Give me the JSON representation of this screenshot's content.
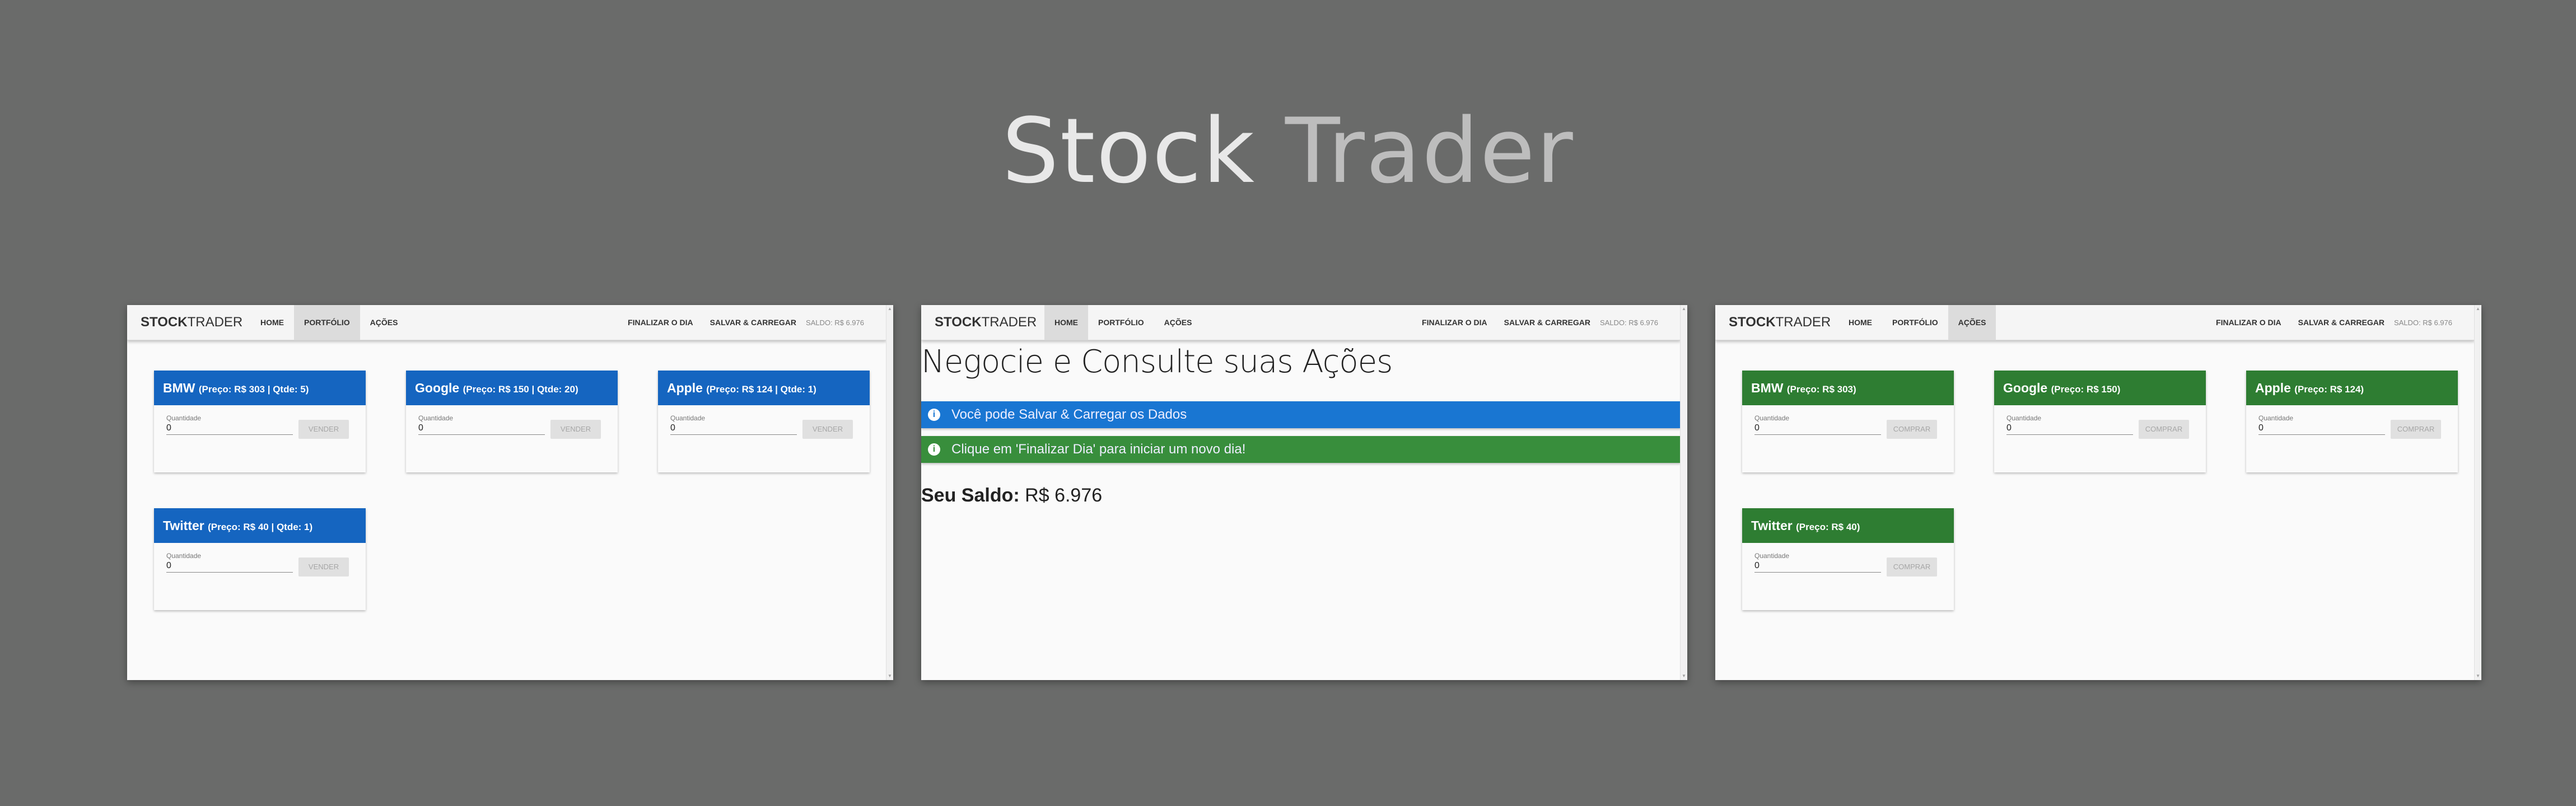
{
  "hero": {
    "word1": "Stock",
    "word2": "Trader"
  },
  "brand": {
    "bold": "STOCK",
    "light": "TRADER"
  },
  "nav": {
    "home": "HOME",
    "portfolio": "PORTFÓLIO",
    "acoes": "AÇÕES",
    "finalizar": "FINALIZAR O DIA",
    "salvar": "SALVAR & CARREGAR",
    "saldo": "SALDO: R$ 6.976"
  },
  "portfolio": {
    "quantity_label": "Quantidade",
    "button_label": "VENDER",
    "stocks": [
      {
        "name": "BMW",
        "details": "(Preço: R$ 303 | Qtde: 5)",
        "quantity": "0"
      },
      {
        "name": "Google",
        "details": "(Preço: R$ 150 | Qtde: 20)",
        "quantity": "0"
      },
      {
        "name": "Apple",
        "details": "(Preço: R$ 124 | Qtde: 1)",
        "quantity": "0"
      },
      {
        "name": "Twitter",
        "details": "(Preço: R$ 40 | Qtde: 1)",
        "quantity": "0"
      }
    ]
  },
  "home": {
    "title": "Negocie e Consulte suas Ações",
    "alert_info": "Você pode Salvar & Carregar os Dados",
    "alert_success": "Clique em 'Finalizar Dia' para iniciar um novo dia!",
    "saldo_label": "Seu Saldo:",
    "saldo_value": "R$ 6.976"
  },
  "acoes": {
    "quantity_label": "Quantidade",
    "button_label": "COMPRAR",
    "stocks": [
      {
        "name": "BMW",
        "details": "(Preço: R$ 303)",
        "quantity": "0"
      },
      {
        "name": "Google",
        "details": "(Preço: R$ 150)",
        "quantity": "0"
      },
      {
        "name": "Apple",
        "details": "(Preço: R$ 124)",
        "quantity": "0"
      },
      {
        "name": "Twitter",
        "details": "(Preço: R$ 40)",
        "quantity": "0"
      }
    ]
  },
  "colors": {
    "background": "#6a6b6a",
    "portfolio_card": "#1565c0",
    "acoes_card": "#2e7d32",
    "alert_info": "#1976d2",
    "alert_success": "#388e3c"
  },
  "icons": {
    "alert": "info-circle-icon"
  }
}
